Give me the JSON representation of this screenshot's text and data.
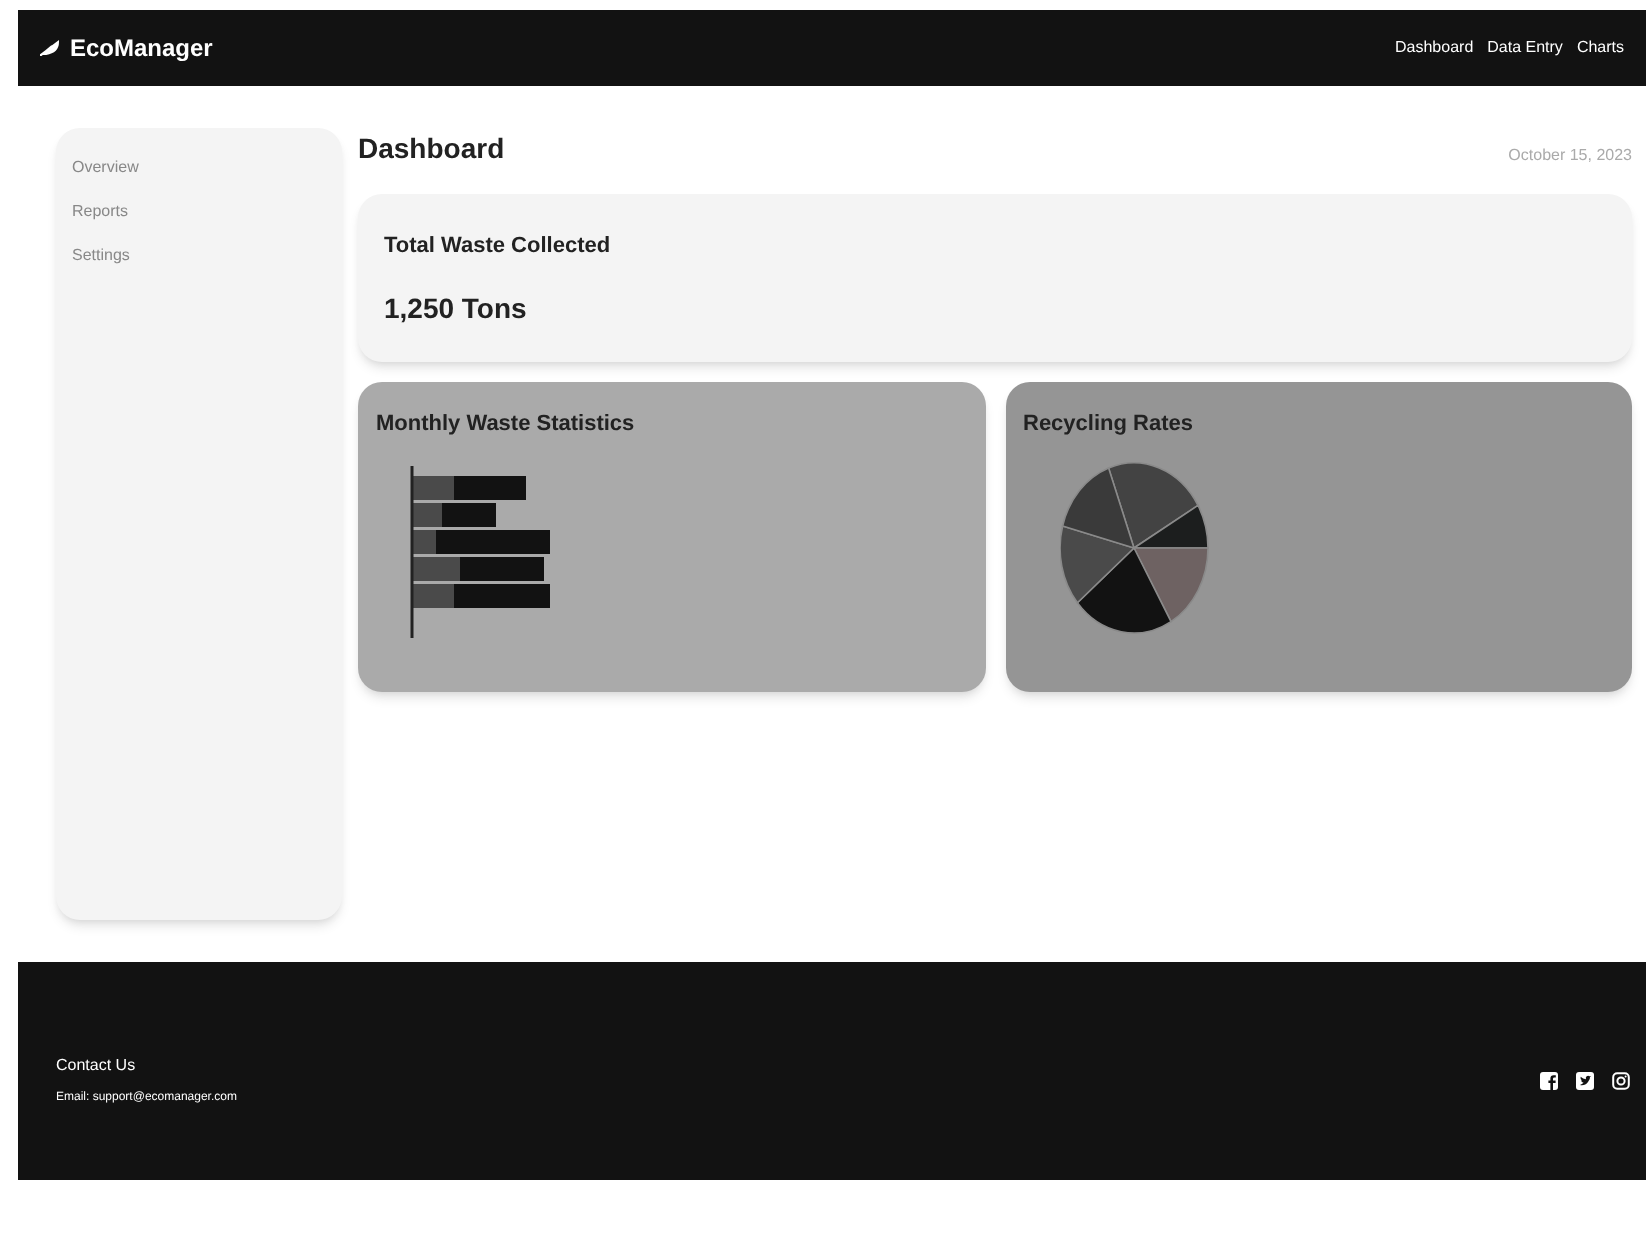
{
  "header": {
    "logo": "EcoManager",
    "nav": [
      {
        "label": "Dashboard"
      },
      {
        "label": "Data Entry"
      },
      {
        "label": "Charts"
      }
    ]
  },
  "sidebar": {
    "items": [
      {
        "label": "Overview"
      },
      {
        "label": "Reports"
      },
      {
        "label": "Settings"
      }
    ]
  },
  "main": {
    "title": "Dashboard",
    "date": "October 15, 2023",
    "summary": {
      "label": "Total Waste Collected",
      "value": "1,250 Tons"
    },
    "panels": [
      {
        "kind": "bar",
        "title": "Monthly Waste Statistics"
      },
      {
        "kind": "pie",
        "title": "Recycling Rates"
      }
    ]
  },
  "footer": {
    "heading": "Contact Us",
    "email": "Email: support@ecomanager.com",
    "social": [
      {
        "kind": "facebook"
      },
      {
        "kind": "twitter"
      },
      {
        "kind": "instagram"
      }
    ]
  }
}
